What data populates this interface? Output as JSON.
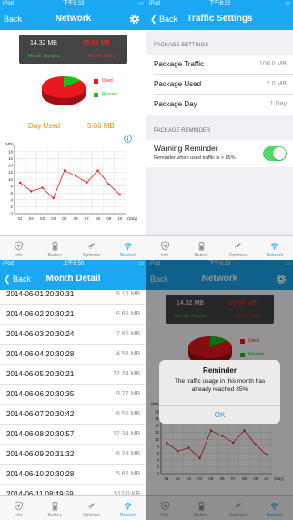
{
  "status_bar": {
    "carrier": "iPod",
    "wifi_icon": "wifi-icon",
    "times": [
      "下午8:33",
      "下午8:33",
      "上午8:50",
      "下午8:33"
    ],
    "battery_icon": "battery-icon"
  },
  "tabs": [
    {
      "label": "Info",
      "icon": "shield-plus-icon"
    },
    {
      "label": "Battery",
      "icon": "battery-icon"
    },
    {
      "label": "Optimize",
      "icon": "rocket-icon"
    },
    {
      "label": "Network",
      "icon": "wifi-icon"
    }
  ],
  "active_tab": "Network",
  "network": {
    "back_label": "Back",
    "title": "Network",
    "settings_icon": "gear-icon",
    "surplus_value": "14.32 MB",
    "used_value": "85.68 MB",
    "surplus_label": "Month Surplus",
    "used_label": "Month Used",
    "pie_legend": [
      {
        "label": "Used",
        "color": "#e8181e"
      },
      {
        "label": "Remain",
        "color": "#18c21c"
      }
    ],
    "pie_data": {
      "used_fraction": 0.857,
      "remain_fraction": 0.143
    },
    "day_used_label": "Day Used",
    "day_used_value": "5.66 MB",
    "info_icon": "info-icon"
  },
  "chart_data": {
    "type": "line",
    "ylabel": "(MB)",
    "xlabel": "(Day)",
    "x": [
      "01",
      "02",
      "03",
      "04",
      "05",
      "06",
      "07",
      "08",
      "09",
      "10"
    ],
    "y_ticks": [
      0,
      2,
      4,
      6,
      8,
      10,
      12,
      14,
      16,
      18
    ],
    "ylim": [
      0,
      19
    ],
    "series": [
      {
        "values": [
          9,
          6.5,
          7.5,
          4.5,
          12.5,
          11,
          9,
          12.5,
          8.5,
          5.5
        ],
        "color": "#e8181e"
      }
    ],
    "grid": true
  },
  "traffic_settings": {
    "back_label": "Back",
    "title": "Traffic Settings",
    "section1": "PACKAGE SETTINGS",
    "rows": [
      {
        "label": "Package Traffic",
        "value": "100.0 MB"
      },
      {
        "label": "Package Used",
        "value": "2.0 MB"
      },
      {
        "label": "Package Day",
        "value": "1 Day"
      }
    ],
    "section2": "PACKAGE REMINDER",
    "reminder_label": "Warning Reminder",
    "reminder_sub": "Reminder when used traffic is > 85%",
    "reminder_on": true
  },
  "month_detail": {
    "back_label": "Back",
    "title": "Month Detail",
    "entries": [
      {
        "date": "2014-06-01 20:30:31",
        "size": "9.16 MB"
      },
      {
        "date": "2014-06-02 20:30:21",
        "size": "6.65 MB"
      },
      {
        "date": "2014-06-03 20:30:24",
        "size": "7.80 MB"
      },
      {
        "date": "2014-06-04 20:30:28",
        "size": "4.53 MB"
      },
      {
        "date": "2014-06-05 20:30:21",
        "size": "12.34 MB"
      },
      {
        "date": "2014-06-06 20:30:35",
        "size": "9.77 MB"
      },
      {
        "date": "2014-06-07 20:30:42",
        "size": "8.55 MB"
      },
      {
        "date": "2014-06-08 20:30:57",
        "size": "12.34 MB"
      },
      {
        "date": "2014-06-09 20:31:32",
        "size": "8.29 MB"
      },
      {
        "date": "2014-06-10 20:30:28",
        "size": "5.66 MB"
      },
      {
        "date": "2014-06-11 08:49:59",
        "size": "512.0 KB"
      }
    ]
  },
  "alert": {
    "title": "Reminder",
    "message": "The traffic usage in this month has already reached 85%",
    "button": "OK"
  }
}
